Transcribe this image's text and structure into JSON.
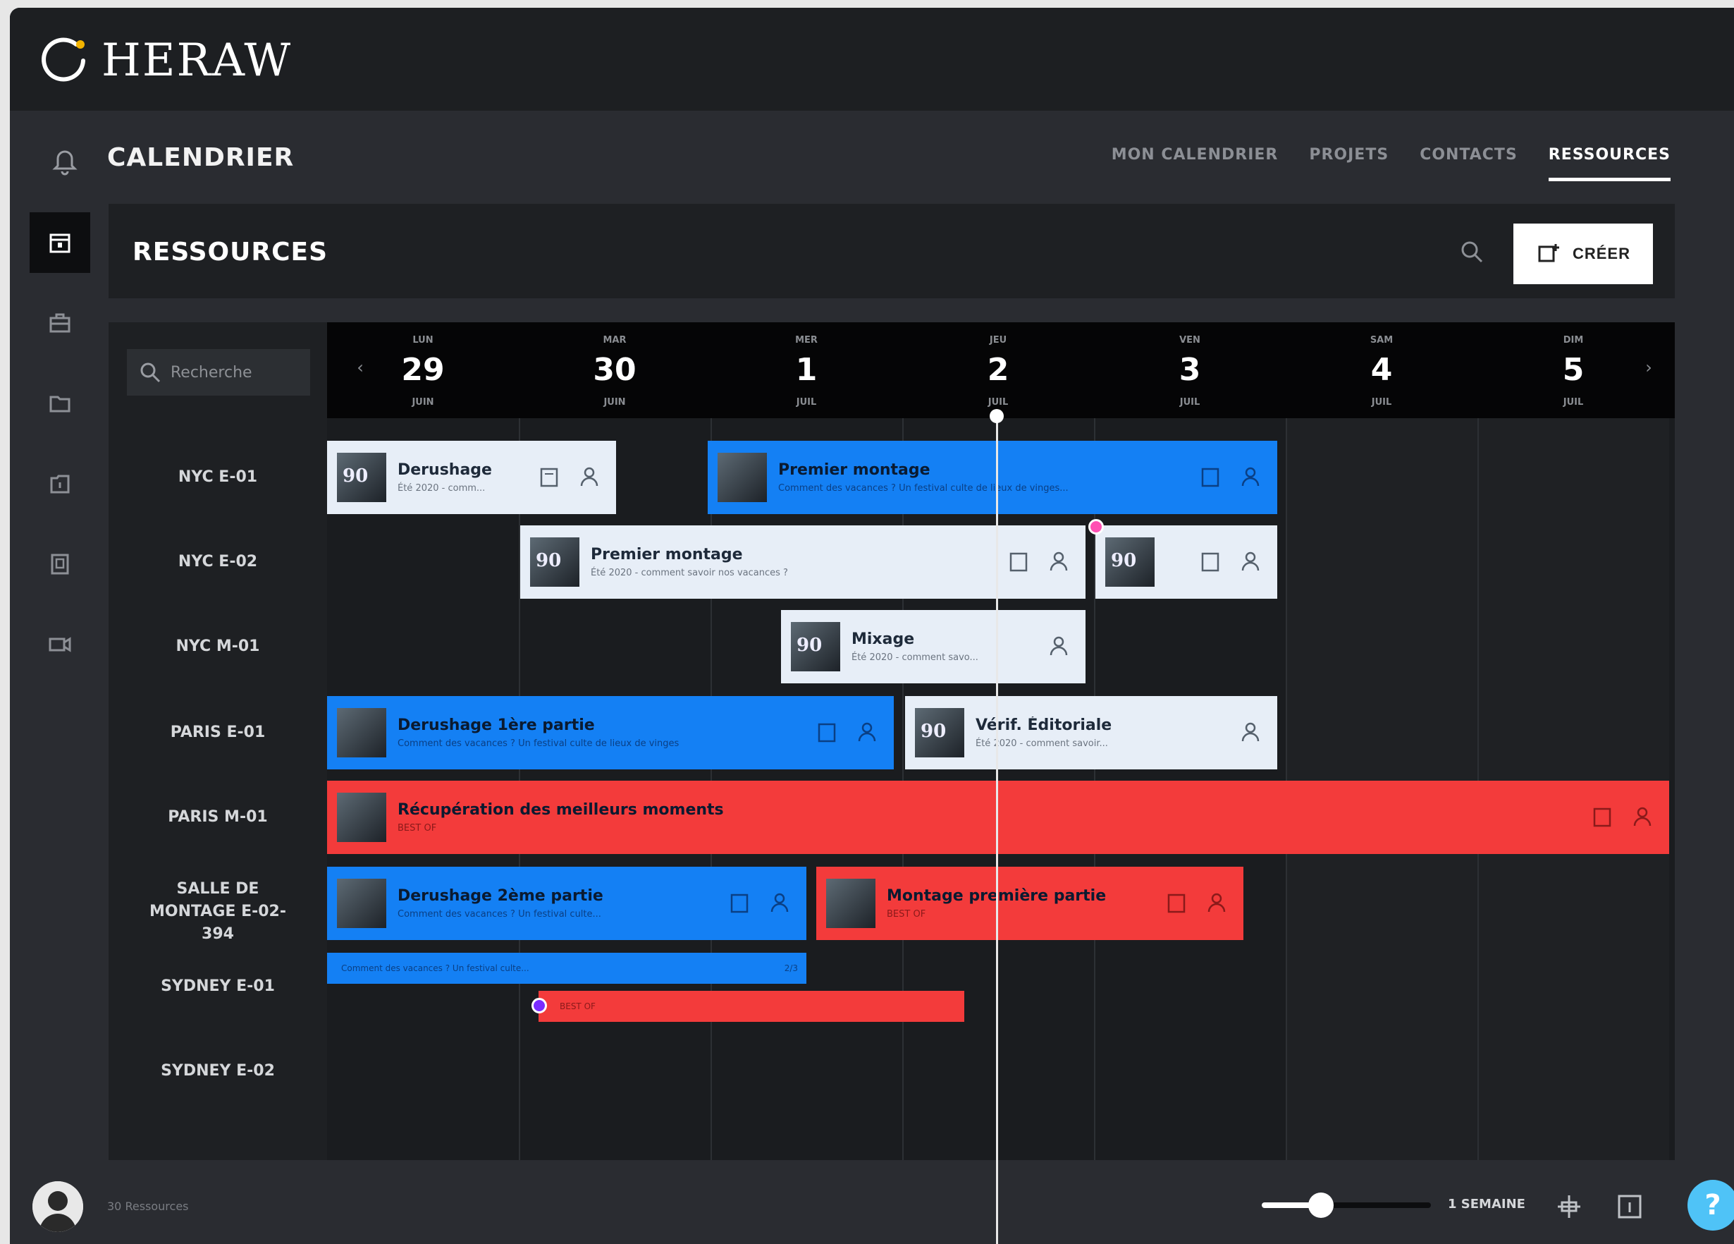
{
  "app": {
    "brand": "HERAW"
  },
  "header": {
    "section_title": "CALENDRIER"
  },
  "tabs": [
    {
      "label": "MON CALENDRIER",
      "active": false
    },
    {
      "label": "PROJETS",
      "active": false
    },
    {
      "label": "CONTACTS",
      "active": false
    },
    {
      "label": "RESSOURCES",
      "active": true
    }
  ],
  "sidebar": {
    "items": [
      {
        "icon": "calendar-icon",
        "active": true
      },
      {
        "icon": "briefcase-icon",
        "active": false
      },
      {
        "icon": "folder-icon",
        "active": false
      },
      {
        "icon": "document-icon",
        "active": false
      },
      {
        "icon": "contact-card-icon",
        "active": false
      },
      {
        "icon": "video-camera-icon",
        "active": false
      }
    ]
  },
  "panel": {
    "title": "RESSOURCES",
    "create_label": "CRÉER"
  },
  "resource_search": {
    "placeholder": "Recherche"
  },
  "days": [
    {
      "weekday": "LUN",
      "day": "29",
      "month": "JUIN"
    },
    {
      "weekday": "MAR",
      "day": "30",
      "month": "JUIN"
    },
    {
      "weekday": "MER",
      "day": "1",
      "month": "JUIL"
    },
    {
      "weekday": "JEU",
      "day": "2",
      "month": "JUIL"
    },
    {
      "weekday": "VEN",
      "day": "3",
      "month": "JUIL"
    },
    {
      "weekday": "SAM",
      "day": "4",
      "month": "JUIL"
    },
    {
      "weekday": "DIM",
      "day": "5",
      "month": "JUIL"
    }
  ],
  "resources": [
    "NYC E-01",
    "NYC E-02",
    "NYC M-01",
    "PARIS E-01",
    "PARIS M-01",
    "SALLE DE MONTAGE E-02-394",
    "SYDNEY E-01",
    "SYDNEY E-02"
  ],
  "events": [
    {
      "title": "Derushage",
      "subtitle": "Été 2020 - comm..."
    },
    {
      "title": "Premier montage",
      "subtitle": "Comment des vacances ? Un festival culte de lieux de vinges..."
    },
    {
      "title": "Premier montage",
      "subtitle": "Été 2020 - comment savoir nos vacances ?"
    },
    {
      "title": "",
      "subtitle": ""
    },
    {
      "title": "Mixage",
      "subtitle": "Été 2020 - comment savo..."
    },
    {
      "title": "Derushage 1ère partie",
      "subtitle": "Comment des vacances ? Un festival culte de lieux de vinges"
    },
    {
      "title": "Vérif. Éditoriale",
      "subtitle": "Été 2020 - comment savoir..."
    },
    {
      "title": "Récupération des meilleurs moments",
      "subtitle": "BEST OF"
    },
    {
      "title": "Derushage 2ème partie",
      "subtitle": "Comment des vacances ? Un festival culte..."
    },
    {
      "title": "Montage première partie",
      "subtitle": "BEST OF"
    }
  ],
  "thin_events": [
    {
      "text": "Comment des vacances ? Un festival culte...",
      "count": "2/3"
    },
    {
      "text": "BEST OF",
      "count": ""
    }
  ],
  "footer": {
    "count_label": "30 Ressources",
    "period_label": "1 SEMAINE",
    "zoom_level": 0.35
  },
  "help": {
    "label": "?"
  },
  "colors": {
    "blue": "#1480f4",
    "red": "#f33b3b",
    "light": "#e7eef7",
    "accent_dot": "#ff4fb3"
  }
}
